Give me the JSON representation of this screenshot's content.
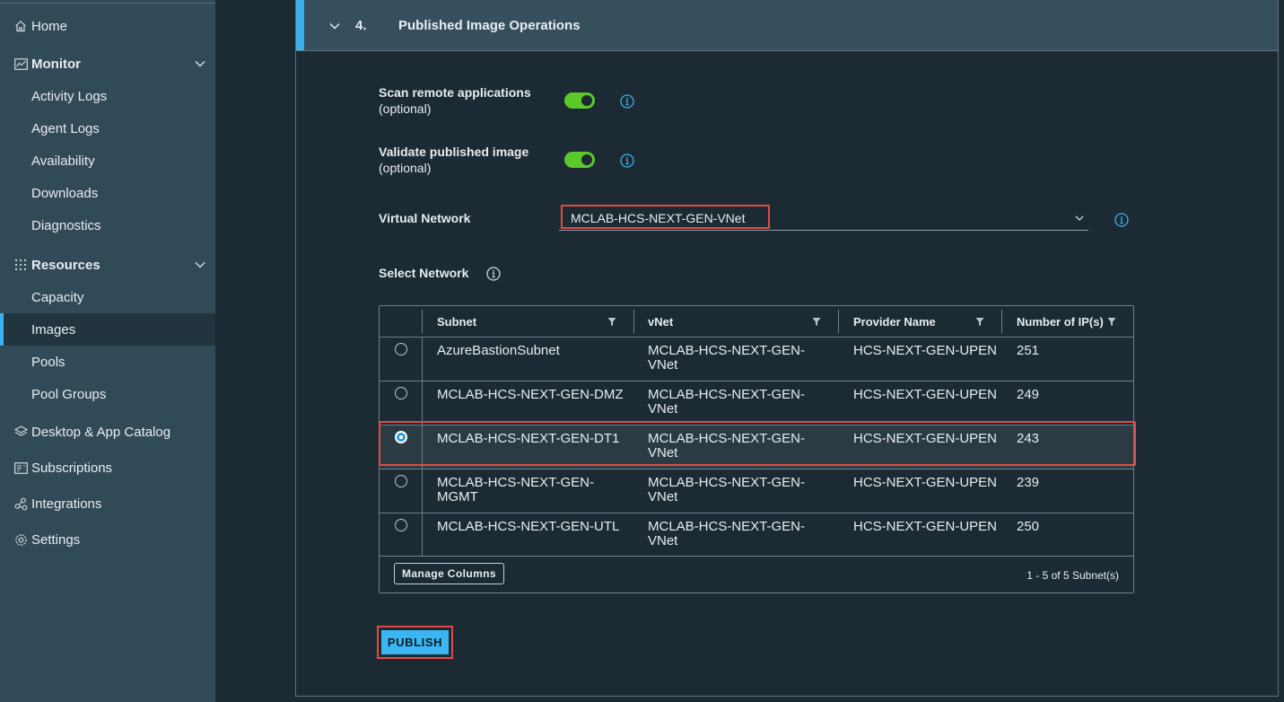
{
  "sidebar": {
    "home": "Home",
    "monitor": "Monitor",
    "activity_logs": "Activity Logs",
    "agent_logs": "Agent Logs",
    "availability": "Availability",
    "downloads": "Downloads",
    "diagnostics": "Diagnostics",
    "resources": "Resources",
    "capacity": "Capacity",
    "images": "Images",
    "pools": "Pools",
    "pool_groups": "Pool Groups",
    "catalog": "Desktop & App Catalog",
    "subscriptions": "Subscriptions",
    "integrations": "Integrations",
    "settings": "Settings",
    "active": "Images"
  },
  "section": {
    "step": "4.",
    "title": "Published Image Operations"
  },
  "form": {
    "scan_label": "Scan remote applications",
    "scan_optional": "(optional)",
    "scan_on": true,
    "validate_label": "Validate published image",
    "validate_optional": "(optional)",
    "validate_on": true,
    "vnet_label": "Virtual Network",
    "vnet_value": "MCLAB-HCS-NEXT-GEN-VNet",
    "select_network_label": "Select Network"
  },
  "table": {
    "columns": [
      "Subnet",
      "vNet",
      "Provider Name",
      "Number of IP(s)"
    ],
    "rows": [
      {
        "subnet_1": "AzureBastionSubnet",
        "subnet_2": "",
        "vnet_1": "MCLAB-HCS-NEXT-GEN-",
        "vnet_2": "VNet",
        "provider": "HCS-NEXT-GEN-UPEN",
        "ips": "251",
        "selected": false
      },
      {
        "subnet_1": "MCLAB-HCS-NEXT-GEN-DMZ",
        "subnet_2": "",
        "vnet_1": "MCLAB-HCS-NEXT-GEN-",
        "vnet_2": "VNet",
        "provider": "HCS-NEXT-GEN-UPEN",
        "ips": "249",
        "selected": false
      },
      {
        "subnet_1": "MCLAB-HCS-NEXT-GEN-DT1",
        "subnet_2": "",
        "vnet_1": "MCLAB-HCS-NEXT-GEN-",
        "vnet_2": "VNet",
        "provider": "HCS-NEXT-GEN-UPEN",
        "ips": "243",
        "selected": true
      },
      {
        "subnet_1": "MCLAB-HCS-NEXT-GEN-",
        "subnet_2": "MGMT",
        "vnet_1": "MCLAB-HCS-NEXT-GEN-",
        "vnet_2": "VNet",
        "provider": "HCS-NEXT-GEN-UPEN",
        "ips": "239",
        "selected": false
      },
      {
        "subnet_1": "MCLAB-HCS-NEXT-GEN-UTL",
        "subnet_2": "",
        "vnet_1": "MCLAB-HCS-NEXT-GEN-",
        "vnet_2": "VNet",
        "provider": "HCS-NEXT-GEN-UPEN",
        "ips": "250",
        "selected": false
      }
    ],
    "manage_columns": "Manage Columns",
    "pager": "1 - 5 of 5 Subnet(s)"
  },
  "actions": {
    "publish": "PUBLISH"
  },
  "colors": {
    "accent": "#3bb0ee",
    "toggle_on": "#5bc82c",
    "highlight": "#e24b45"
  },
  "icons": [
    "home-icon",
    "monitor-icon",
    "resources-icon",
    "catalog-icon",
    "subscriptions-icon",
    "integrations-icon",
    "settings-icon",
    "chevron-down-icon",
    "info-icon",
    "filter-icon"
  ]
}
